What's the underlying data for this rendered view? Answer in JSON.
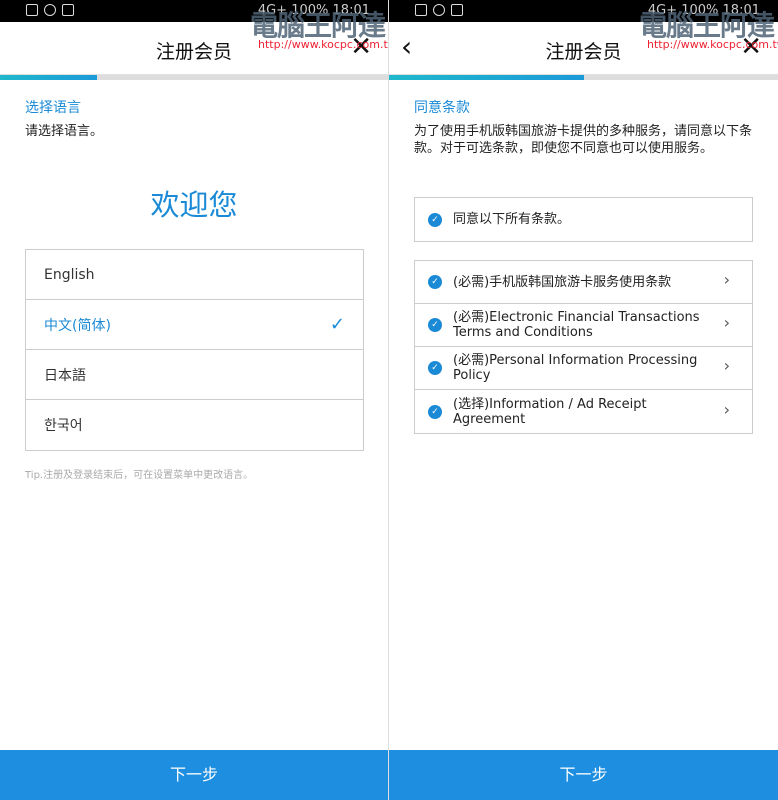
{
  "status": {
    "battery": "100%",
    "time": "18:01",
    "network": "4G+"
  },
  "watermark": {
    "name": "電腦王阿達",
    "url": "http://www.kocpc.com.tw"
  },
  "colors": {
    "accent": "#1b8ad6",
    "button": "#1e8fe0",
    "progress": "#1fb8cc"
  },
  "left": {
    "header": {
      "title": "注册会员"
    },
    "progress": 0.25,
    "section_title": "选择语言",
    "description": "请选择语言。",
    "welcome": "欢迎您",
    "languages": [
      {
        "label": "English",
        "selected": false
      },
      {
        "label": "中文(简体)",
        "selected": true
      },
      {
        "label": "日本語",
        "selected": false
      },
      {
        "label": "한국어",
        "selected": false
      }
    ],
    "tip": "Tip.注册及登录结束后，可在设置菜单中更改语言。",
    "next_label": "下一步"
  },
  "right": {
    "header": {
      "title": "注册会员"
    },
    "progress": 0.5,
    "section_title": "同意条款",
    "description": "为了使用手机版韩国旅游卡提供的多种服务，请同意以下条款。对于可选条款，即使您不同意也可以使用服务。",
    "agree_all": "同意以下所有条款。",
    "terms": [
      "(必需)手机版韩国旅游卡服务使用条款",
      "(必需)Electronic Financial Transactions Terms and Conditions",
      "(必需)Personal Information Processing Policy",
      "(选择)Information / Ad Receipt Agreement"
    ],
    "next_label": "下一步"
  }
}
